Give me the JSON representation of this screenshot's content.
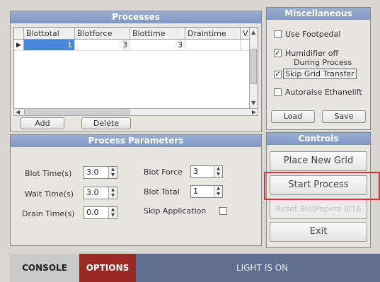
{
  "processes": {
    "title": "Processes",
    "columns": [
      "Blottotal",
      "Blotforce",
      "Blottime",
      "Draintime",
      "V"
    ],
    "rows": [
      {
        "marker": "▶",
        "blottotal": "1",
        "blotforce": "3",
        "blottime": "3",
        "draintime": ""
      }
    ],
    "add_label": "Add",
    "delete_label": "Delete"
  },
  "params": {
    "title": "Process Parameters",
    "blot_time_label": "Blot Time(s)",
    "blot_time_value": "3.0",
    "wait_time_label": "Wait Time(s)",
    "wait_time_value": "3.0",
    "drain_time_label": "Drain Time(s)",
    "drain_time_value": "0.0",
    "blot_force_label": "Blot Force",
    "blot_force_value": "3",
    "blot_total_label": "Blot Total",
    "blot_total_value": "1",
    "skip_application_label": "Skip Application",
    "skip_application_checked": false
  },
  "misc": {
    "title": "Miscellaneous",
    "use_footpedal_label": "Use Footpedal",
    "use_footpedal_checked": false,
    "humidifier_label_1": "Humidifier off",
    "humidifier_label_2": "During Process",
    "humidifier_checked": true,
    "skip_grid_label": "Skip Grid Transfer",
    "skip_grid_checked": true,
    "autoraise_label": "Autoraise Ethanelift",
    "autoraise_checked": false,
    "load_label": "Load",
    "save_label": "Save"
  },
  "controls": {
    "title": "Controls",
    "place_new_grid": "Place New Grid",
    "start_process": "Start Process",
    "reset_blotpapers": "Reset BlotPapers 0/16",
    "exit": "Exit"
  },
  "bottom": {
    "console": "CONSOLE",
    "options": "OPTIONS",
    "light_status": "LIGHT IS ON"
  },
  "colors": {
    "title_bar": "#7f98c4",
    "options_tab": "#9b2a23",
    "bottom_bar": "#5f6f90",
    "highlight": "#e03030",
    "selection": "#4a86d8"
  }
}
